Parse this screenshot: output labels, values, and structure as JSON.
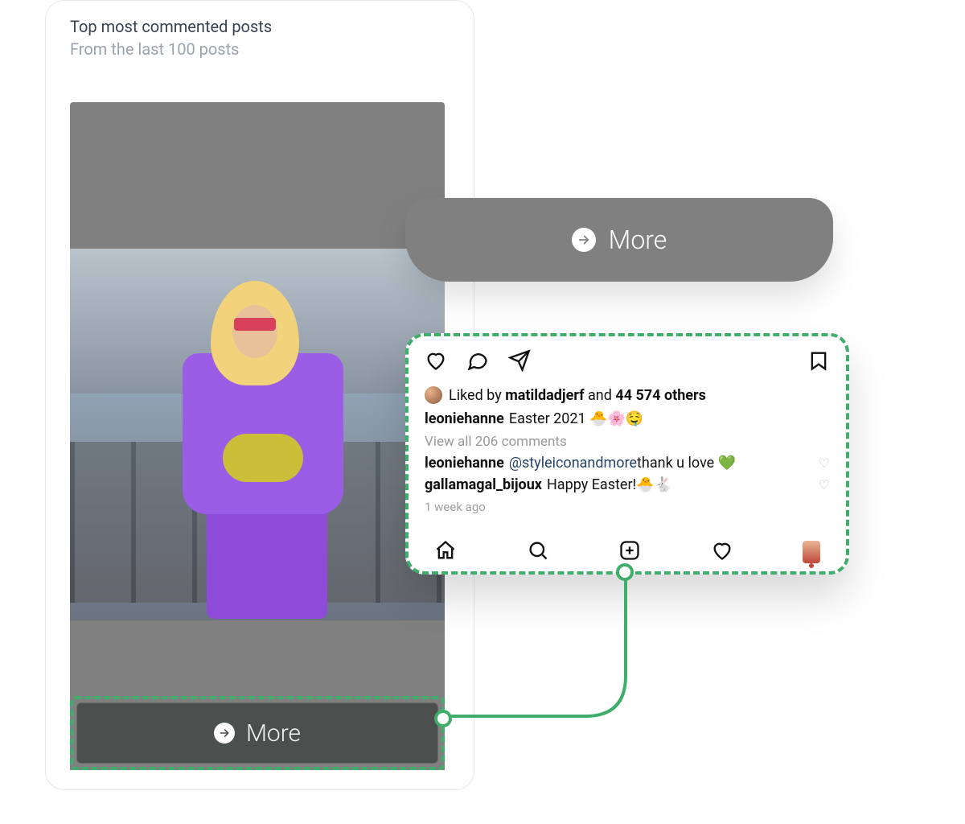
{
  "analytics": {
    "title": "Top most commented posts",
    "subtitle": "From the last 100 posts"
  },
  "more_pill": {
    "label": "More"
  },
  "more_bottom": {
    "label": "More"
  },
  "ig": {
    "likes": {
      "prefix": "Liked by",
      "user": "matildadjerf",
      "middle": "and",
      "others": "44 574 others"
    },
    "caption": {
      "user": "leoniehanne",
      "text": "Easter 2021 🐣🌸🤤"
    },
    "viewall": "View all 206 comments",
    "comments": [
      {
        "user": "leoniehanne",
        "mention": "@styleiconandmore",
        "text": " thank u love 💚"
      },
      {
        "user": "gallamagal_bijoux",
        "mention": "",
        "text": "Happy Easter!🐣🐇"
      }
    ],
    "time": "1 week ago"
  }
}
